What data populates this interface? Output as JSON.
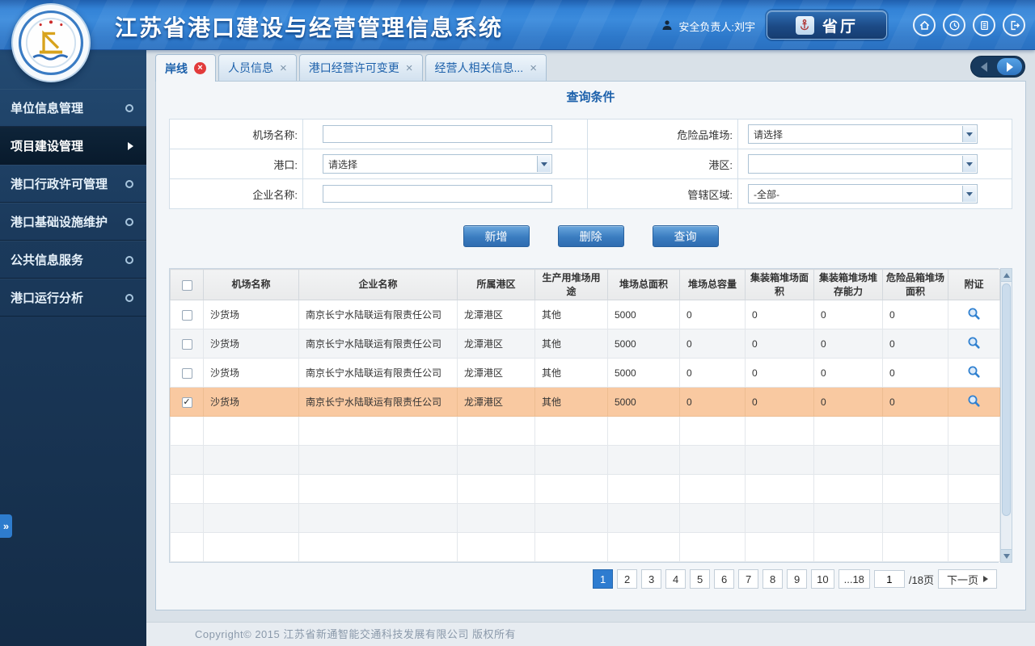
{
  "colors": {
    "accent": "#2e7cd0",
    "selected_row": "#f9c9a1",
    "tab_close_red": "#e23b3b"
  },
  "header": {
    "title": "江苏省港口建设与经营管理信息系统",
    "user": "安全负责人:刘宇",
    "org_button": "省厅"
  },
  "sidebar": {
    "items": [
      {
        "label": "单位信息管理",
        "active": false
      },
      {
        "label": "项目建设管理",
        "active": true
      },
      {
        "label": "港口行政许可管理",
        "active": false
      },
      {
        "label": "港口基础设施维护",
        "active": false
      },
      {
        "label": "公共信息服务",
        "active": false
      },
      {
        "label": "港口运行分析",
        "active": false
      }
    ]
  },
  "tabs": [
    {
      "label": "岸线",
      "active": true
    },
    {
      "label": "人员信息",
      "active": false
    },
    {
      "label": "港口经营许可变更",
      "active": false
    },
    {
      "label": "经营人相关信息...",
      "active": false
    }
  ],
  "query": {
    "title": "查询条件",
    "rows": [
      {
        "left_label": "机场名称:",
        "left_type": "input",
        "left_value": "",
        "right_label": "危险品堆场:",
        "right_type": "select",
        "right_value": "请选择"
      },
      {
        "left_label": "港口:",
        "left_type": "select",
        "left_value": "请选择",
        "right_label": "港区:",
        "right_type": "select",
        "right_value": ""
      },
      {
        "left_label": "企业名称:",
        "left_type": "input",
        "left_value": "",
        "right_label": "管辖区域:",
        "right_type": "select",
        "right_value": "-全部-"
      }
    ],
    "buttons": [
      {
        "label": "新增"
      },
      {
        "label": "删除"
      },
      {
        "label": "查询"
      }
    ]
  },
  "table": {
    "headers": [
      "机场名称",
      "企业名称",
      "所属港区",
      "生产用堆场用途",
      "堆场总面积",
      "堆场总容量",
      "集装箱堆场面积",
      "集装箱堆场堆存能力",
      "危险品箱堆场面积",
      "附证"
    ],
    "rows": [
      {
        "checked": false,
        "selected": false,
        "cells": [
          "沙货场",
          "南京长宁水陆联运有限责任公司",
          "龙潭港区",
          "其他",
          "5000",
          "0",
          "0",
          "0",
          "0"
        ]
      },
      {
        "checked": false,
        "selected": false,
        "cells": [
          "沙货场",
          "南京长宁水陆联运有限责任公司",
          "龙潭港区",
          "其他",
          "5000",
          "0",
          "0",
          "0",
          "0"
        ]
      },
      {
        "checked": false,
        "selected": false,
        "cells": [
          "沙货场",
          "南京长宁水陆联运有限责任公司",
          "龙潭港区",
          "其他",
          "5000",
          "0",
          "0",
          "0",
          "0"
        ]
      },
      {
        "checked": true,
        "selected": true,
        "cells": [
          "沙货场",
          "南京长宁水陆联运有限责任公司",
          "龙潭港区",
          "其他",
          "5000",
          "0",
          "0",
          "0",
          "0"
        ]
      }
    ]
  },
  "pagination": {
    "pages": [
      "1",
      "2",
      "3",
      "4",
      "5",
      "6",
      "7",
      "8",
      "9",
      "10",
      "...18"
    ],
    "active_page": "1",
    "input_value": "1",
    "total_label": "/18页",
    "next_label": "下一页"
  },
  "footer": {
    "text": "Copyright©  2015  江苏省新通智能交通科技发展有限公司  版权所有"
  }
}
